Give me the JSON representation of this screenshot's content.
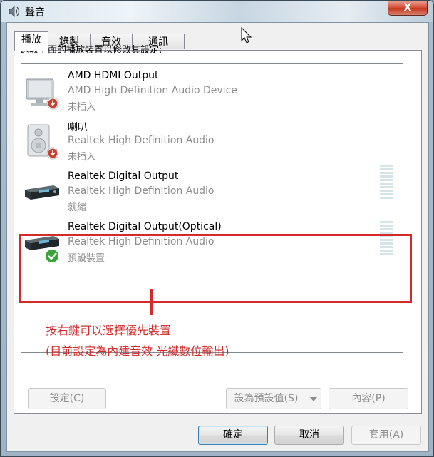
{
  "window": {
    "title": "聲音",
    "close_glyph": "X"
  },
  "tabs": [
    {
      "label": "播放",
      "active": true
    },
    {
      "label": "錄製",
      "active": false
    },
    {
      "label": "音效",
      "active": false
    },
    {
      "label": "通訊",
      "active": false
    }
  ],
  "instruction": "選取下面的播放裝置以修改其設定:",
  "devices": [
    {
      "name": "AMD HDMI Output",
      "description": "AMD High Definition Audio Device",
      "status": "未插入",
      "icon": "monitor-icon",
      "badge": "unplugged-badge-icon"
    },
    {
      "name": "喇叭",
      "description": "Realtek High Definition Audio",
      "status": "未插入",
      "icon": "speaker-icon",
      "badge": "unplugged-badge-icon"
    },
    {
      "name": "Realtek Digital Output",
      "description": "Realtek High Definition Audio",
      "status": "就緒",
      "icon": "digital-receiver-icon",
      "badge": ""
    },
    {
      "name": "Realtek Digital Output(Optical)",
      "description": "Realtek High Definition Audio",
      "status": "預設裝置",
      "icon": "digital-receiver-icon",
      "badge": "default-check-icon"
    }
  ],
  "buttons": {
    "configure": "設定(C)",
    "set_default": "設為預設值(S)",
    "properties": "內容(P)",
    "ok": "確定",
    "cancel": "取消",
    "apply": "套用(A)"
  },
  "annotation": {
    "line1": "按右鍵可以選擇優先裝置",
    "line2": "(目前設定為內建音效 光纖數位輸出)",
    "color": "#d32b2b"
  },
  "colors": {
    "accent": "#3c7fb1",
    "disabled_text": "#8e8e8e"
  }
}
